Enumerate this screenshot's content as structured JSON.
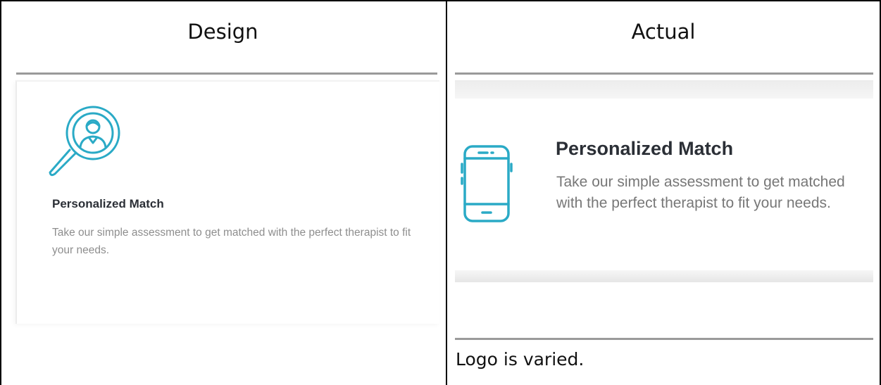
{
  "columns": {
    "design_header": "Design",
    "actual_header": "Actual"
  },
  "design": {
    "icon": "magnifier-person-icon",
    "title": "Personalized Match",
    "description": "Take our simple assessment to get matched with the perfect therapist to fit your needs."
  },
  "actual": {
    "icon": "smartphone-icon",
    "title": "Personalized Match",
    "description": "Take our simple assessment to get matched with the perfect therapist to fit your needs."
  },
  "note": "Logo is varied.",
  "colors": {
    "accent": "#2AAAC6",
    "title": "#2b2f36",
    "body": "#8e8e8e",
    "rule": "#9a9a9a"
  }
}
